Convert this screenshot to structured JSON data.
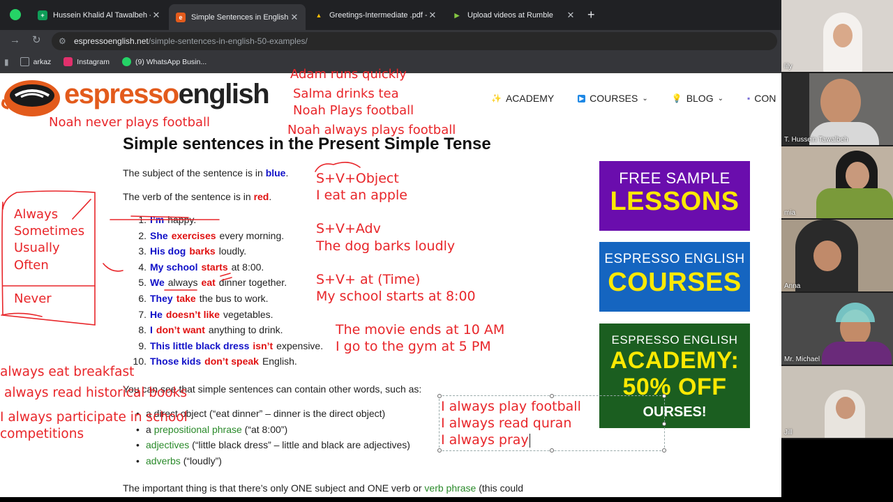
{
  "browser": {
    "tabs": [
      {
        "title": "Hussein Khalid Al Tawalbeh - G",
        "color": "#0f9d58",
        "glyph": "+"
      },
      {
        "title": "Simple Sentences in English: 50",
        "color": "#e35b1c",
        "glyph": "e"
      },
      {
        "title": "Greetings-Intermediate .pdf - G",
        "color": "#fbbc04",
        "glyph": "▲"
      },
      {
        "title": "Upload videos at Rumble",
        "color": "#85c742",
        "glyph": "▶"
      }
    ],
    "new_tab": "+",
    "url_host": "espressoenglish.net",
    "url_path": "/simple-sentences-in-english-50-examples/",
    "bookmarks": [
      {
        "label": "arkaz",
        "color": "#9aa0a6"
      },
      {
        "label": "Instagram",
        "color": "#e1306c"
      },
      {
        "label": "(9) WhatsApp Busin...",
        "color": "#25d366"
      }
    ]
  },
  "site": {
    "logo_accent": "espresso",
    "logo_plain": "english",
    "nav": [
      {
        "label": "ACADEMY",
        "icon": "✨",
        "chevron": false
      },
      {
        "label": "COURSES",
        "icon": "▶",
        "chevron": true
      },
      {
        "label": "BLOG",
        "icon": "💡",
        "chevron": true
      },
      {
        "label": "CON",
        "icon": "▪",
        "chevron": false
      }
    ]
  },
  "article": {
    "title": "Simple sentences in the Present Simple Tense",
    "subject_intro": "The subject of the sentence is in ",
    "subject_color_word": "blue",
    "verb_intro": "The verb of the sentence is in ",
    "verb_color_word": "red",
    "examples": [
      {
        "num": "1.",
        "subject": "I’m",
        "verb": "",
        "rest": "happy."
      },
      {
        "num": "2.",
        "subject": "She",
        "verb": "exercises",
        "rest": "every morning."
      },
      {
        "num": "3.",
        "subject": "His dog",
        "verb": "barks",
        "rest": "loudly."
      },
      {
        "num": "4.",
        "subject": "My school",
        "verb": "starts",
        "rest": "at 8:00."
      },
      {
        "num": "5.",
        "subject": "We",
        "verb": "eat",
        "pre": "always",
        "rest": "dinner together."
      },
      {
        "num": "6.",
        "subject": "They",
        "verb": "take",
        "rest": "the bus to work."
      },
      {
        "num": "7.",
        "subject": "He",
        "verb": "doesn’t like",
        "rest": "vegetables."
      },
      {
        "num": "8.",
        "subject": "I",
        "verb": "don’t want",
        "rest": "anything to drink."
      },
      {
        "num": "9.",
        "subject": "This little black dress",
        "verb": "isn’t",
        "rest": "expensive."
      },
      {
        "num": "10.",
        "subject": "Those kids",
        "verb": "don’t speak",
        "rest": "English."
      }
    ],
    "other_words": "You can see that simple sentences can contain other words, such as:",
    "bullets": [
      {
        "pre": "a direct object (“eat dinner” – dinner is the direct object)",
        "green": "",
        "post": ""
      },
      {
        "pre": "a ",
        "green": "prepositional phrase",
        "post": " (“at 8:00”)"
      },
      {
        "pre": "",
        "green": "adjectives",
        "post": " (“little black dress” – little and black are adjectives)"
      },
      {
        "pre": "",
        "green": "adverbs",
        "post": " (“loudly”)"
      }
    ],
    "bottom_pre": "The important thing is that there’s only ONE subject and ONE verb or ",
    "bottom_green": "verb phrase",
    "bottom_post": " (this could"
  },
  "ads": {
    "sample": {
      "l1": "FREE SAMPLE",
      "l2": "LESSONS"
    },
    "courses": {
      "l1": "ESPRESSO ENGLISH",
      "l2": "COURSES"
    },
    "academy": {
      "l1": "ESPRESSO ENGLISH",
      "l2a": "ACADEMY:",
      "l2b": "50% OFF",
      "l3": "OURSES!"
    }
  },
  "annotations": {
    "top_list": [
      "Adam runs quickly",
      "Salma drinks tea",
      "Noah Plays football",
      "Noah always plays football"
    ],
    "noah_never": "Noah never plays football",
    "frequency": [
      "Always",
      "Sometimes",
      "Usually",
      "Often"
    ],
    "never": "Never",
    "patterns": [
      "S+V+Object",
      "I eat an apple",
      "S+V+Adv",
      "The dog barks loudly",
      "S+V+ at (Time)",
      "My school starts at 8:00",
      "The movie ends at 10 AM",
      "I go to the gym at 5 PM"
    ],
    "left_notes": [
      "always eat breakfast",
      "always read historical books",
      "I always participate in school",
      "competitions"
    ],
    "textbox_lines": [
      "I always play football",
      "I always read quran",
      "I always pray"
    ]
  },
  "participants": [
    {
      "name": "lily",
      "bg": "#d9d4cf"
    },
    {
      "name": "T. Hussein Tawalbeh",
      "bg": "#6b6a68"
    },
    {
      "name": "mia",
      "bg": "#bfb2a2"
    },
    {
      "name": "Anna",
      "bg": "#a89a88"
    },
    {
      "name": "Mr. Michael",
      "bg": "#4a4a4a"
    },
    {
      "name": "Jill",
      "bg": "#c9c2b8"
    }
  ]
}
